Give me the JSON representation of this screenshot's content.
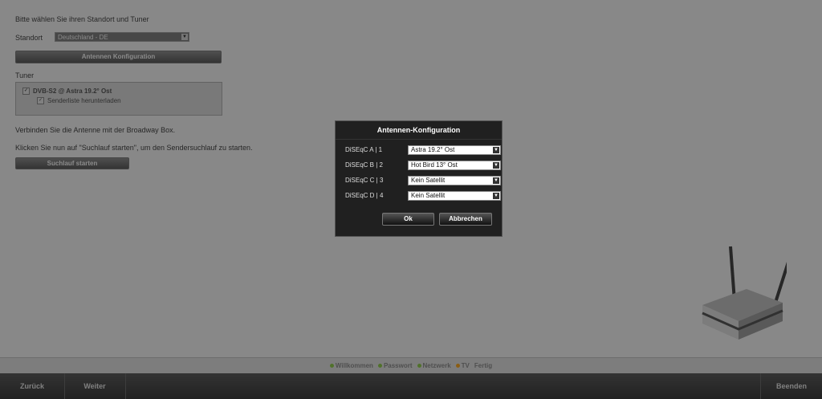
{
  "setup": {
    "intro": "Bitte wählen Sie ihren Standort und Tuner",
    "standort_label": "Standort",
    "standort_value": "Deutschland - DE",
    "antenna_button": "Antennen Konfiguration",
    "tuner_label": "Tuner",
    "tuner_option": "DVB-S2 @ Astra 19.2° Ost",
    "download_option": "Senderliste herunterladen",
    "connect_text": "Verbinden Sie die Antenne mit der Broadway Box.",
    "click_text": "Klicken Sie nun auf \"Suchlauf starten\", um den Sendersuchlauf zu starten.",
    "scan_button": "Suchlauf starten"
  },
  "progress": {
    "steps": [
      {
        "label": "Willkommen",
        "color": "#8bc34a"
      },
      {
        "label": "Passwort",
        "color": "#8bc34a"
      },
      {
        "label": "Netzwerk",
        "color": "#8bc34a"
      },
      {
        "label": "TV",
        "color": "#f0a020"
      },
      {
        "label": "Fertig",
        "color": ""
      }
    ]
  },
  "nav": {
    "back": "Zurück",
    "next": "Weiter",
    "end": "Beenden"
  },
  "dialog": {
    "title": "Antennen-Konfiguration",
    "rows": [
      {
        "label": "DiSEqC A | 1",
        "value": "Astra 19.2° Ost"
      },
      {
        "label": "DiSEqC B | 2",
        "value": "Hot Bird 13° Ost"
      },
      {
        "label": "DiSEqC C | 3",
        "value": "Kein Satellit"
      },
      {
        "label": "DiSEqC D | 4",
        "value": "Kein Satellit"
      }
    ],
    "ok": "Ok",
    "cancel": "Abbrechen"
  },
  "icons": {
    "select_arrow": "chevron-down-icon",
    "checkbox": "checkbox-checked-icon",
    "router": "router-icon"
  }
}
